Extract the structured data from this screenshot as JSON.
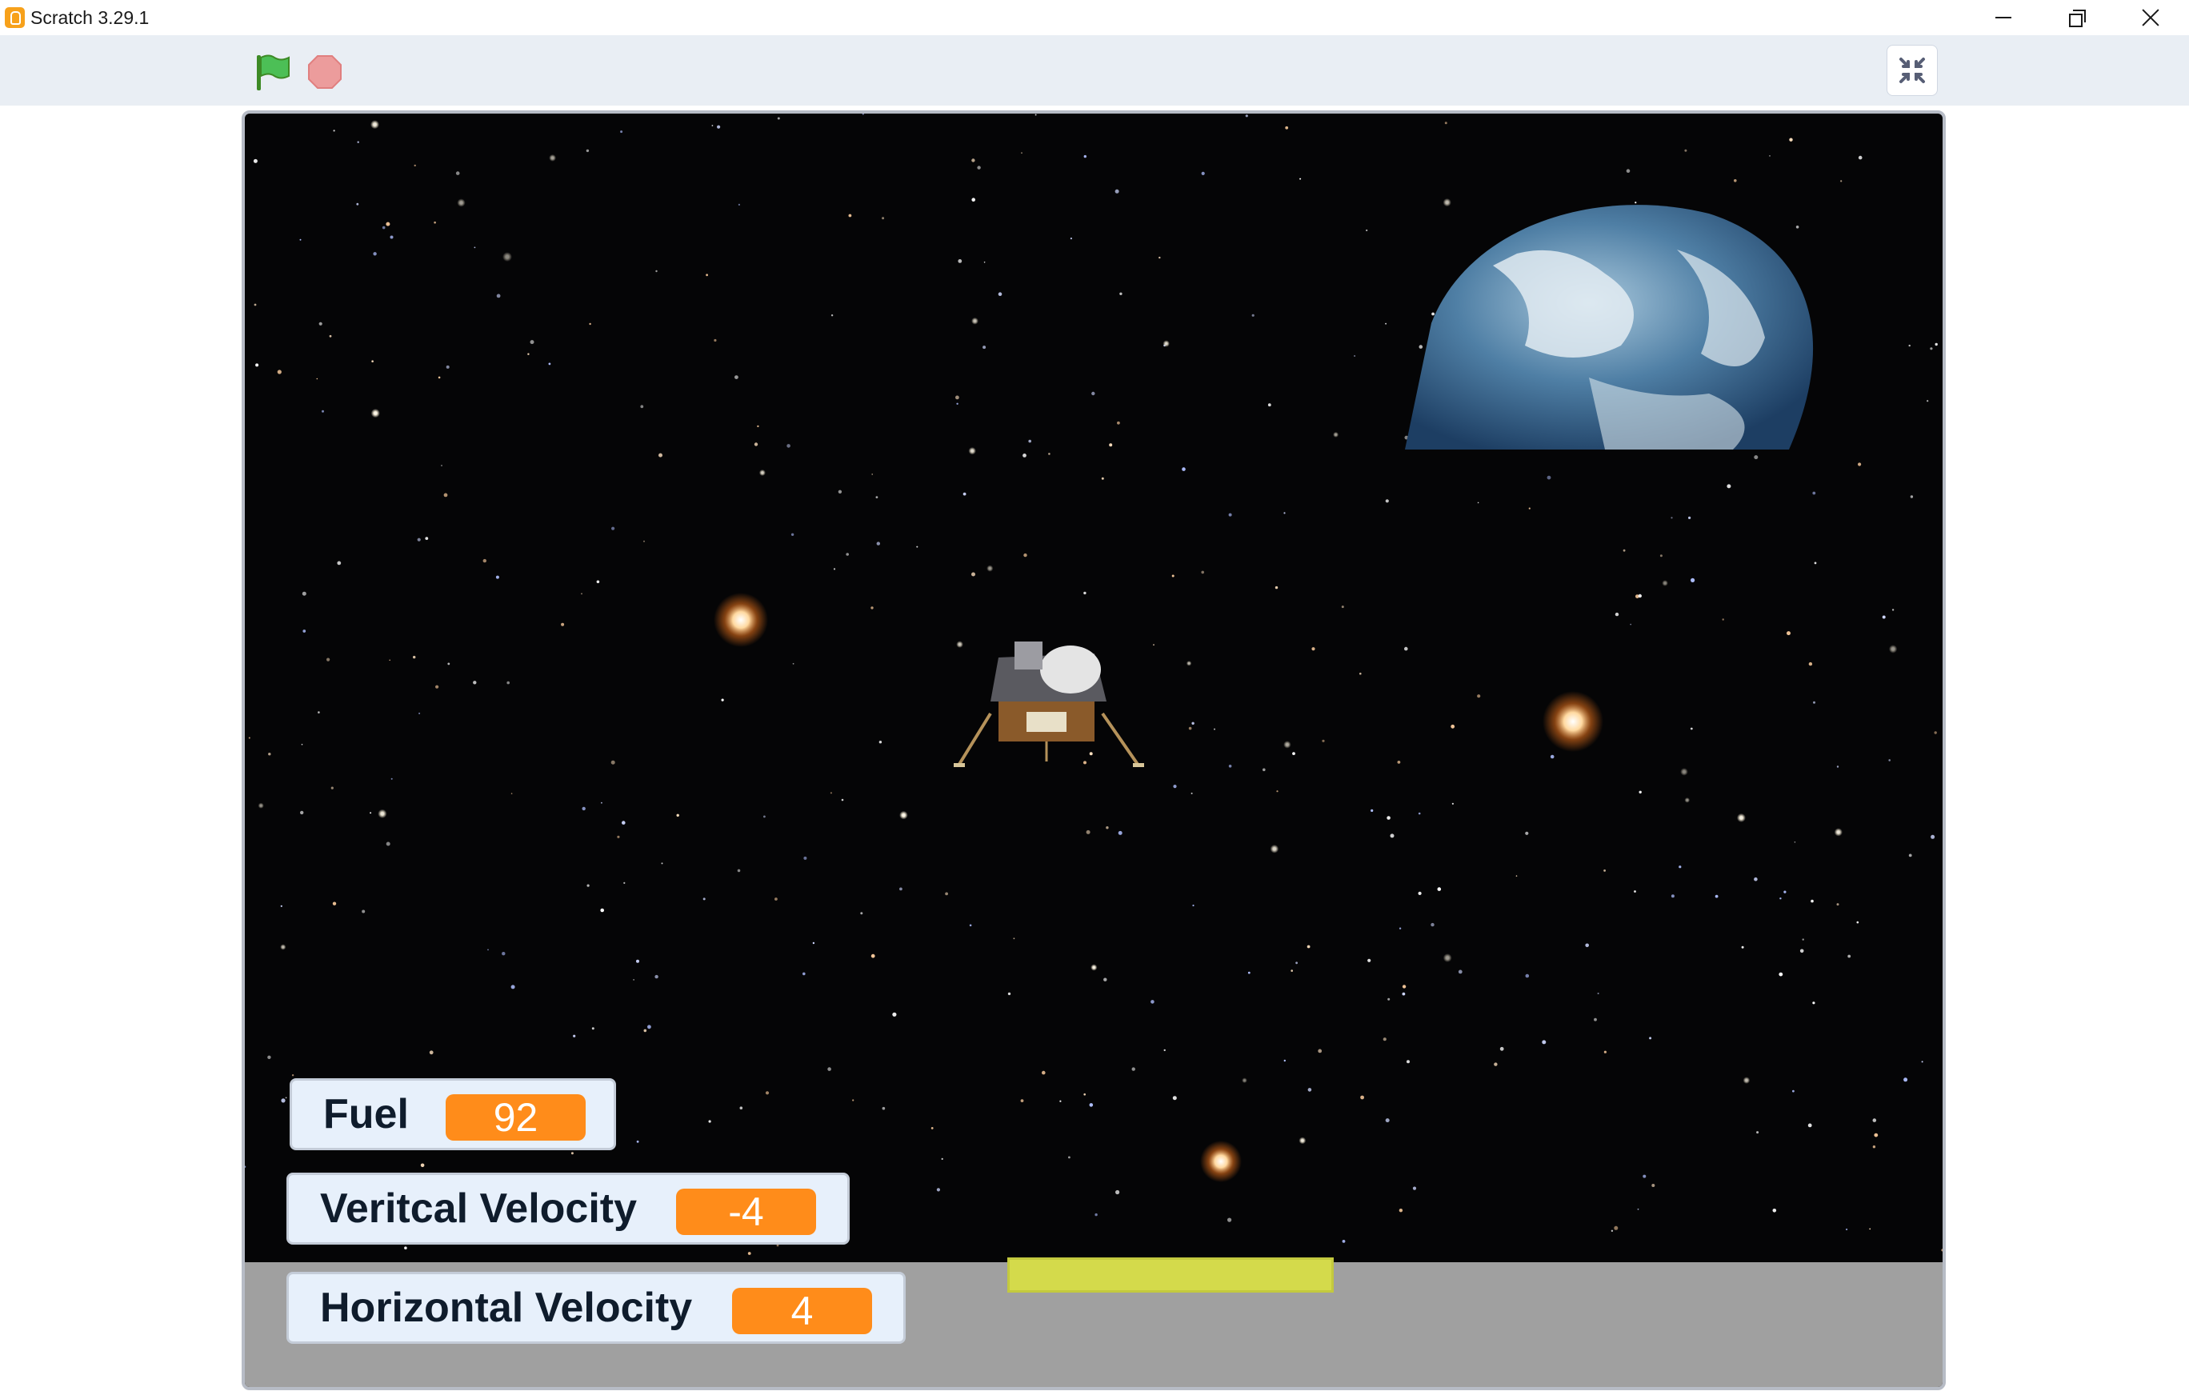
{
  "window": {
    "title": "Scratch 3.29.1",
    "controls": [
      "minimize",
      "restore",
      "close"
    ]
  },
  "toolbar": {
    "green_flag_icon": "green-flag-icon",
    "stop_icon": "stop-sign-icon",
    "fullscreen_exit_icon": "exit-fullscreen-icon"
  },
  "stage": {
    "sprites": [
      "earth",
      "lunar-module",
      "landing-pad"
    ],
    "monitors": [
      {
        "label": "Fuel",
        "value": "92"
      },
      {
        "label": "Veritcal Velocity",
        "value": "-4"
      },
      {
        "label": "Horizontal Velocity",
        "value": "4"
      }
    ]
  },
  "colors": {
    "monitor_value_bg": "#ff8c1a",
    "landing_pad": "#d4da4b",
    "ground": "#a0a0a0",
    "toolbar_bg": "#e9eef4"
  }
}
